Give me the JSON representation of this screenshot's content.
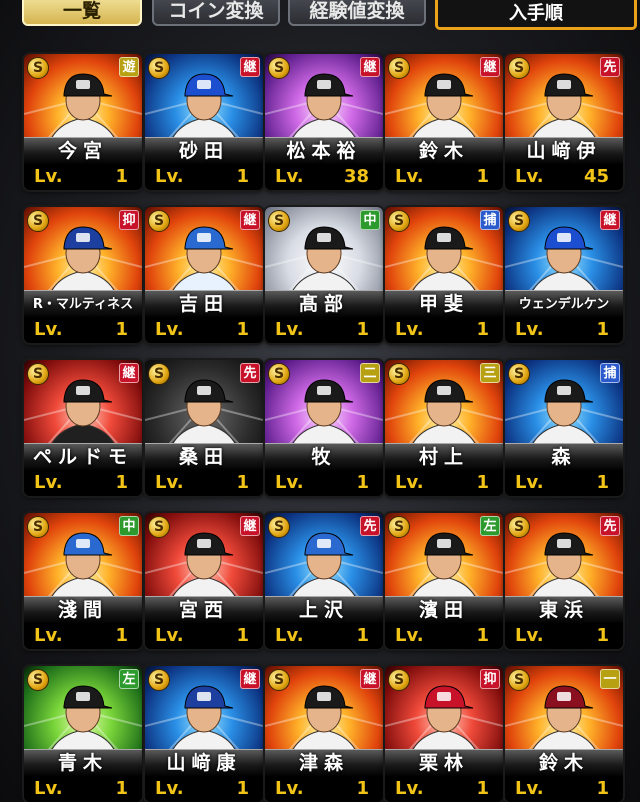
{
  "tabs": [
    {
      "label": "一覧",
      "active": true
    },
    {
      "label": "コイン変換",
      "active": false
    },
    {
      "label": "経験値変換",
      "active": false
    }
  ],
  "sort": {
    "label": "入手順"
  },
  "coin_glyph": "S",
  "level_prefix": "Lv.",
  "position_colors": {
    "遊": "#b8a013",
    "継": "#c8122a",
    "先": "#c8122a",
    "抑": "#c8122a",
    "中": "#2c9a2c",
    "左": "#2c9a2c",
    "捕": "#2a5acc",
    "二": "#b8a013",
    "三": "#b8a013",
    "一": "#b8a013"
  },
  "cards": [
    {
      "name": "今宮",
      "pos": "遊",
      "level": "1",
      "bg": "fire",
      "cap": "#1a1a1a",
      "shirt": "#f2f2f2"
    },
    {
      "name": "砂田",
      "pos": "継",
      "level": "1",
      "bg": "blue",
      "cap": "#1c4fd0",
      "shirt": "#f2f2f2"
    },
    {
      "name": "松本裕",
      "pos": "継",
      "level": "38",
      "bg": "purple",
      "cap": "#1a1a1a",
      "shirt": "#f2f2f2"
    },
    {
      "name": "鈴木",
      "pos": "継",
      "level": "1",
      "bg": "fire",
      "cap": "#1a1a1a",
      "shirt": "#f2f2f2"
    },
    {
      "name": "山﨑伊",
      "pos": "先",
      "level": "45",
      "bg": "fire",
      "cap": "#1a1a1a",
      "shirt": "#f2f2f2"
    },
    {
      "name": "R・マルティネス",
      "pos": "抑",
      "level": "1",
      "bg": "fire",
      "cap": "#1c3fa0",
      "shirt": "#f2f2f2"
    },
    {
      "name": "吉田",
      "pos": "継",
      "level": "1",
      "bg": "fire",
      "cap": "#2a6ad0",
      "shirt": "#e8f2ff"
    },
    {
      "name": "髙部",
      "pos": "中",
      "level": "1",
      "bg": "white",
      "cap": "#1a1a1a",
      "shirt": "#f2f2f2"
    },
    {
      "name": "甲斐",
      "pos": "捕",
      "level": "1",
      "bg": "fire",
      "cap": "#1a1a1a",
      "shirt": "#f2f2f2"
    },
    {
      "name": "ウェンデルケン",
      "pos": "継",
      "level": "1",
      "bg": "blue",
      "cap": "#1c4fd0",
      "shirt": "#f2f2f2"
    },
    {
      "name": "ペルドモ",
      "pos": "継",
      "level": "1",
      "bg": "red",
      "cap": "#1a1a1a",
      "shirt": "#202020"
    },
    {
      "name": "桑田",
      "pos": "先",
      "level": "1",
      "bg": "dark",
      "cap": "#1a1a1a",
      "shirt": "#f2f2f2"
    },
    {
      "name": "牧",
      "pos": "二",
      "level": "1",
      "bg": "purple",
      "cap": "#1a1a1a",
      "shirt": "#f2f2f2"
    },
    {
      "name": "村上",
      "pos": "三",
      "level": "1",
      "bg": "fire",
      "cap": "#1a1a1a",
      "shirt": "#f2f2f2"
    },
    {
      "name": "森",
      "pos": "捕",
      "level": "1",
      "bg": "blue",
      "cap": "#1a1a1a",
      "shirt": "#f2f2f2"
    },
    {
      "name": "淺間",
      "pos": "中",
      "level": "1",
      "bg": "fire",
      "cap": "#2a6ad0",
      "shirt": "#f2f2f2"
    },
    {
      "name": "宮西",
      "pos": "継",
      "level": "1",
      "bg": "red",
      "cap": "#1a1a1a",
      "shirt": "#f2f2f2"
    },
    {
      "name": "上沢",
      "pos": "先",
      "level": "1",
      "bg": "blue",
      "cap": "#2a6ad0",
      "shirt": "#f2f2f2"
    },
    {
      "name": "濱田",
      "pos": "左",
      "level": "1",
      "bg": "fire",
      "cap": "#1a1a1a",
      "shirt": "#f2f2f2"
    },
    {
      "name": "東浜",
      "pos": "先",
      "level": "1",
      "bg": "fire",
      "cap": "#1a1a1a",
      "shirt": "#f2f2f2"
    },
    {
      "name": "青木",
      "pos": "左",
      "level": "1",
      "bg": "green",
      "cap": "#1a1a1a",
      "shirt": "#f2f2f2"
    },
    {
      "name": "山﨑康",
      "pos": "継",
      "level": "1",
      "bg": "blue",
      "cap": "#1c3fa0",
      "shirt": "#f2f2f2"
    },
    {
      "name": "津森",
      "pos": "継",
      "level": "1",
      "bg": "fire",
      "cap": "#1a1a1a",
      "shirt": "#f2f2f2"
    },
    {
      "name": "栗林",
      "pos": "抑",
      "level": "1",
      "bg": "red",
      "cap": "#c8122a",
      "shirt": "#f2f2f2"
    },
    {
      "name": "鈴木",
      "pos": "一",
      "level": "1",
      "bg": "fire",
      "cap": "#8a1020",
      "shirt": "#f2f2f2"
    }
  ]
}
